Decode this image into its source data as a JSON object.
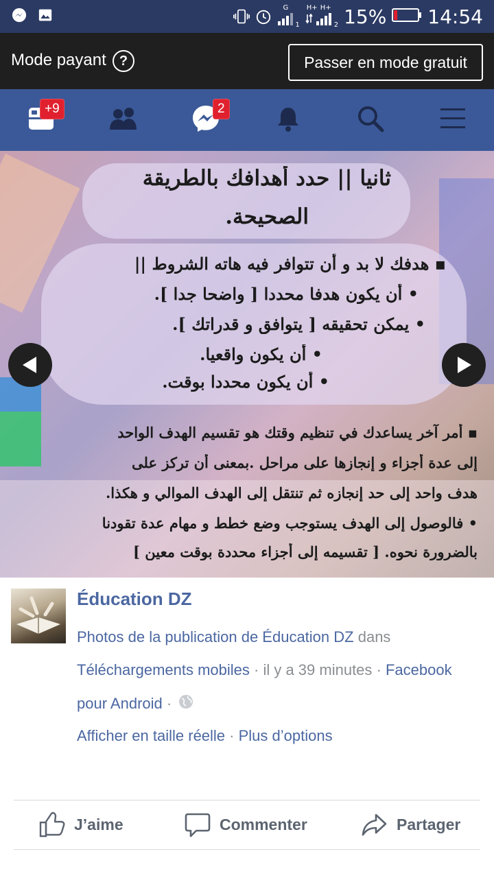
{
  "status_bar": {
    "battery_percent": "15%",
    "time": "14:54",
    "sim1_label": "1",
    "sim2_label": "2",
    "network_labels": [
      "G",
      "H+",
      "H+"
    ],
    "battery_level": 0.15,
    "battery_color": "#e0202e"
  },
  "paid_mode": {
    "label": "Mode payant",
    "help_icon": "?",
    "switch_button": "Passer en mode gratuit"
  },
  "nav": {
    "bg_color": "#3b5998",
    "items": [
      {
        "name": "news-feed-icon",
        "badge": "+9"
      },
      {
        "name": "friends-icon",
        "badge": ""
      },
      {
        "name": "messenger-icon",
        "badge": "2"
      },
      {
        "name": "notifications-bell-icon",
        "badge": ""
      },
      {
        "name": "search-icon",
        "badge": ""
      },
      {
        "name": "menu-icon",
        "badge": ""
      }
    ]
  },
  "photo": {
    "title_lines": [
      "ثانيا || حدد أهدافك بالطريقة",
      "الصحيحة."
    ],
    "block1_lines": [
      "▪ هدفك لا بد و أن تتوافر فيه هاته الشروط ||",
      "• أن يكون هدفا محددا [ واضحا جدا ].",
      "• يمكن تحقيقه [ يتوافق و قدراتك ].",
      "• أن يكون واقعيا.",
      "• أن يكون محددا بوقت."
    ],
    "block2_lines": [
      "▪ أمر آخر يساعدك في تنظيم وقتك هو تقسيم الهدف الواحد",
      "إلى عدة أجزاء و إنجازها على مراحل .بمعنى أن تركز على",
      "هدف واحد إلى حد إنجازه ثم تنتقل إلى الهدف الموالي و هكذا.",
      "• فالوصول إلى الهدف يستوجب وضع خطط و مهام عدة تقودنا",
      "بالضرورة نحوه. [ تقسيمه إلى أجزاء محددة بوقت معين ]"
    ]
  },
  "post": {
    "page_name": "Éducation DZ",
    "line1_link": "Photos de la publication de Éducation DZ",
    "line1_muted": " dans",
    "line2_link": "Téléchargements mobiles",
    "line2_muted": " · il y a 39 minutes · ",
    "line2_link2": "Facebook",
    "line3_link": "pour Android",
    "line3_muted": " · ",
    "line4_link1": "Afficher en taille réelle",
    "line4_sep": " · ",
    "line4_link2": "Plus d’options"
  },
  "actions": {
    "like": "J’aime",
    "comment": "Commenter",
    "share": "Partager"
  }
}
